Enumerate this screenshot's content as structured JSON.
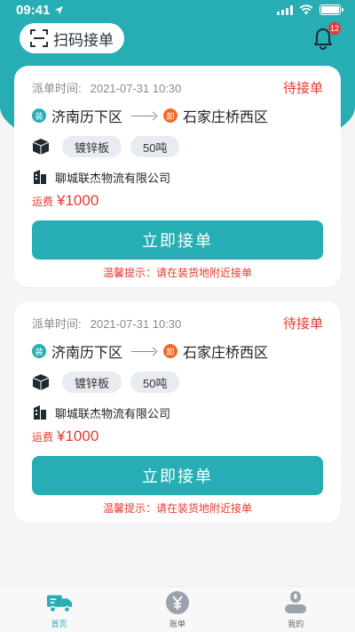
{
  "status_bar": {
    "time": "09:41"
  },
  "header": {
    "scan_label": "扫码接单",
    "notification_count": "12"
  },
  "orders": [
    {
      "dispatch_label": "派单时间:",
      "dispatch_time": "2021-07-31 10:30",
      "status": "待接单",
      "load_pin": "装",
      "origin": "济南历下区",
      "unload_pin": "卸",
      "destination": "石家庄桥西区",
      "material": "镀锌板",
      "weight": "50吨",
      "company": "聊城联杰物流有限公司",
      "fee_label": "运费",
      "fee": "¥1000",
      "accept_label": "立即接单",
      "tip": "温馨提示：请在装货地附近接单"
    },
    {
      "dispatch_label": "派单时间:",
      "dispatch_time": "2021-07-31 10:30",
      "status": "待接单",
      "load_pin": "装",
      "origin": "济南历下区",
      "unload_pin": "卸",
      "destination": "石家庄桥西区",
      "material": "镀锌板",
      "weight": "50吨",
      "company": "聊城联杰物流有限公司",
      "fee_label": "运费",
      "fee": "¥1000",
      "accept_label": "立即接单",
      "tip": "温馨提示：请在装货地附近接单"
    }
  ],
  "tabbar": [
    {
      "label": "首页",
      "icon": "truck-icon",
      "active": true
    },
    {
      "label": "账单",
      "icon": "yuan-icon",
      "active": false
    },
    {
      "label": "我的",
      "icon": "user-icon",
      "active": false
    }
  ],
  "colors": {
    "brand": "#26aeb4",
    "alert": "#e53a2f",
    "unload": "#f06a2a"
  }
}
